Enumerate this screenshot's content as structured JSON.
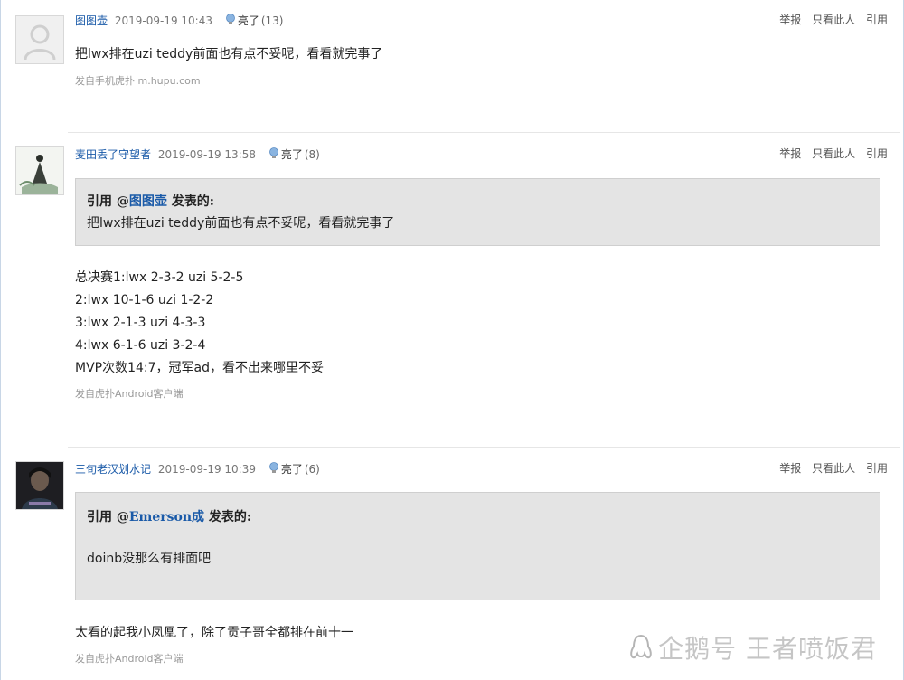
{
  "posts": [
    {
      "username": "图图壶",
      "time": "2019-09-19 10:43",
      "light_label": "亮了",
      "light_count": "(13)",
      "actions": [
        "举报",
        "只看此人",
        "引用"
      ],
      "content": "把lwx排在uzi teddy前面也有点不妥呢，看看就完事了",
      "source": "发自手机虎扑 m.hupu.com"
    },
    {
      "username": "麦田丢了守望者",
      "time": "2019-09-19 13:58",
      "light_label": "亮了",
      "light_count": "(8)",
      "actions": [
        "举报",
        "只看此人",
        "引用"
      ],
      "quote": {
        "prefix": "引用 @",
        "user": "图图壶",
        "suffix": " 发表的:",
        "text": "把lwx排在uzi teddy前面也有点不妥呢，看看就完事了"
      },
      "content_lines": [
        "总决赛1:lwx 2-3-2 uzi 5-2-5",
        "2:lwx 10-1-6 uzi 1-2-2",
        "3:lwx 2-1-3 uzi 4-3-3",
        "4:lwx 6-1-6 uzi 3-2-4",
        "MVP次数14:7，冠军ad，看不出来哪里不妥"
      ],
      "source": "发自虎扑Android客户端"
    },
    {
      "username": "三旬老汉划水记",
      "time": "2019-09-19 10:39",
      "light_label": "亮了",
      "light_count": "(6)",
      "actions": [
        "举报",
        "只看此人",
        "引用"
      ],
      "quote": {
        "prefix": "引用 @",
        "user": "Emerson成",
        "suffix": " 发表的:",
        "text": "doinb没那么有排面吧"
      },
      "content": "太看的起我小凤凰了，除了贡子哥全都排在前十一",
      "source": "发自虎扑Android客户端"
    }
  ],
  "watermark": "企鹅号 王者喷饭君"
}
